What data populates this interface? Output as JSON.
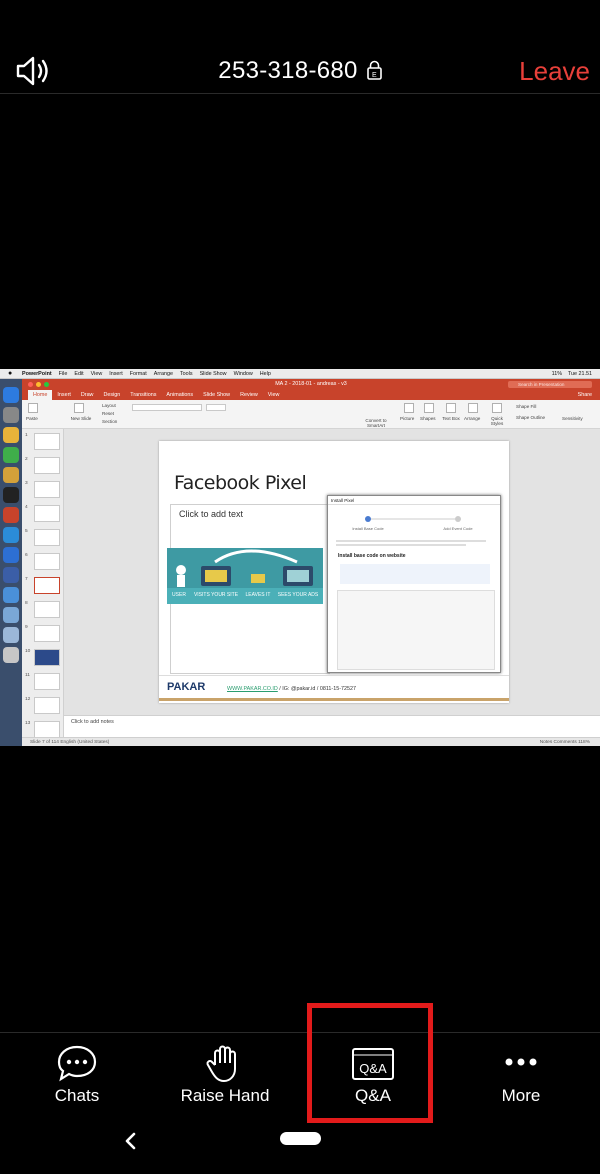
{
  "meeting": {
    "id": "253-318-680",
    "leave_label": "Leave"
  },
  "shared_screen": {
    "mac_menu": [
      "PowerPoint",
      "File",
      "Edit",
      "View",
      "Insert",
      "Format",
      "Arrange",
      "Tools",
      "Slide Show",
      "Window",
      "Help"
    ],
    "clock": "Tue 21.51",
    "battery": "11%",
    "document_title": "MA 2 - 2018-01 - andreas - v3",
    "search_placeholder": "Search in Presentation",
    "ribbon_tabs": [
      "Home",
      "Insert",
      "Draw",
      "Design",
      "Transitions",
      "Animations",
      "Slide Show",
      "Review",
      "View"
    ],
    "share_label": "Share",
    "ribbon_labels": {
      "paste": "Paste",
      "new_slide": "New Slide",
      "layout": "Layout",
      "reset": "Reset",
      "section": "Section",
      "convert_smartart": "Convert to SmartArt",
      "picture": "Picture",
      "shapes": "Shapes",
      "text_box": "Text Box",
      "arrange": "Arrange",
      "quick_styles": "Quick Styles",
      "shape_fill": "Shape Fill",
      "shape_outline": "Shape Outline",
      "sensitivity": "Sensitivity"
    },
    "thumbnail_numbers": [
      "1",
      "2",
      "3",
      "4",
      "5",
      "6",
      "7",
      "8",
      "9",
      "10",
      "11",
      "12",
      "13"
    ],
    "slide": {
      "title": "Facebook Pixel",
      "placeholder": "Click to add text",
      "illustration_labels": [
        "USER",
        "VISITS YOUR SITE",
        "LEAVES IT",
        "SEES YOUR ADS"
      ],
      "popup_title": "Install Pixel",
      "popup_steps": [
        "Install Base Code",
        "Add Event Code"
      ],
      "popup_heading": "Install base code on website",
      "logo": "PAKAR",
      "footer_url": "WWW.PAKAR.CO.ID",
      "footer_rest": " / IG: @pakar.id / 0811-15-72527"
    },
    "notes_placeholder": "Click to add notes",
    "status_left": "Slide 7 of 114     English (United States)",
    "status_right": "Notes    Comments         118%"
  },
  "toolbar": {
    "items": [
      {
        "label": "Chats",
        "icon": "chat-bubble-icon"
      },
      {
        "label": "Raise Hand",
        "icon": "hand-icon"
      },
      {
        "label": "Q&A",
        "icon": "qa-icon"
      },
      {
        "label": "More",
        "icon": "more-dots-icon"
      }
    ],
    "highlighted": "Q&A",
    "highlight_color": "#e21b1b"
  },
  "colors": {
    "leave": "#e8403a",
    "ppt_accent": "#c8432b"
  }
}
